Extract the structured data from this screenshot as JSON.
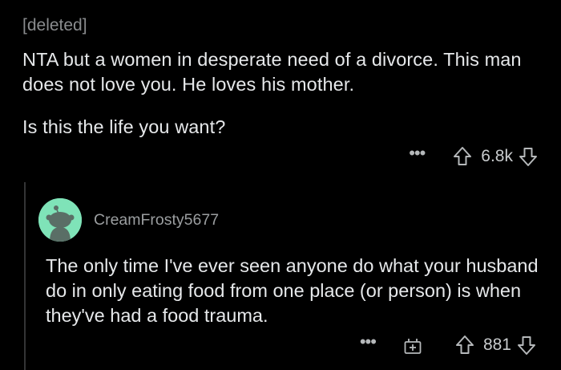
{
  "comment": {
    "author": "[deleted]",
    "body_lines": [
      "NTA but a women in desperate need of a divorce. This man does not love you. He loves his mother.",
      "Is this the life you want?"
    ],
    "more_label": "•••",
    "score": "6.8k"
  },
  "reply": {
    "author": "CreamFrosty5677",
    "body": "The only time I've ever seen anyone do what your husband do in only eating food from one place (or person) is when they've had a food trauma.",
    "more_label": "•••",
    "score": "881",
    "avatar_color": "#7fe3b8"
  },
  "icons": {
    "more": "more-icon",
    "upvote": "upvote-icon",
    "downvote": "downvote-icon",
    "award": "gift-icon",
    "avatar": "snoo-avatar-icon"
  },
  "colors": {
    "background": "#000000",
    "text": "#e6e8ea",
    "meta": "#9b9ea0",
    "thread_line": "#343536"
  }
}
